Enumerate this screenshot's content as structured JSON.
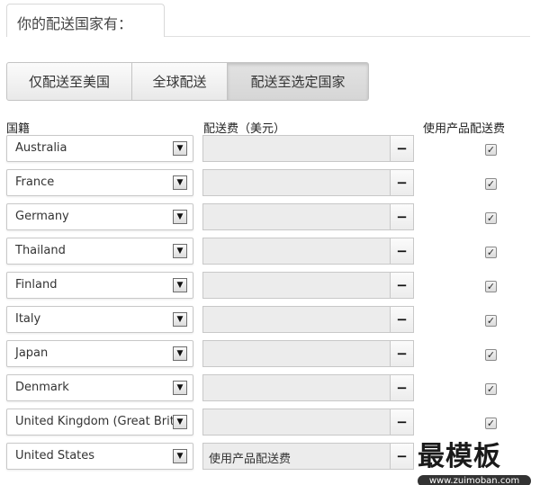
{
  "header": {
    "title": "你的配送国家有："
  },
  "segments": [
    {
      "label": "仅配送至美国",
      "active": false
    },
    {
      "label": "全球配送",
      "active": false
    },
    {
      "label": "配送至选定国家",
      "active": true
    }
  ],
  "columns": {
    "country": "国籍",
    "fee": "配送费（美元）",
    "use_product_fee": "使用产品配送费"
  },
  "controls": {
    "fee_button": "−",
    "dropdown_arrow": "▼",
    "check_mark": "✓"
  },
  "rows": [
    {
      "country": "Australia",
      "fee_text": "",
      "checked": true
    },
    {
      "country": "France",
      "fee_text": "",
      "checked": true
    },
    {
      "country": "Germany",
      "fee_text": "",
      "checked": true
    },
    {
      "country": "Thailand",
      "fee_text": "",
      "checked": true
    },
    {
      "country": "Finland",
      "fee_text": "",
      "checked": true
    },
    {
      "country": "Italy",
      "fee_text": "",
      "checked": true
    },
    {
      "country": "Japan",
      "fee_text": "",
      "checked": true
    },
    {
      "country": "Denmark",
      "fee_text": "",
      "checked": true
    },
    {
      "country": "United Kingdom (Great Britai",
      "fee_text": "",
      "checked": true
    },
    {
      "country": "United States",
      "fee_text": "使用产品配送费",
      "checked": false
    }
  ],
  "watermark": {
    "text": "最模板",
    "url": "www.zuimoban.com"
  }
}
